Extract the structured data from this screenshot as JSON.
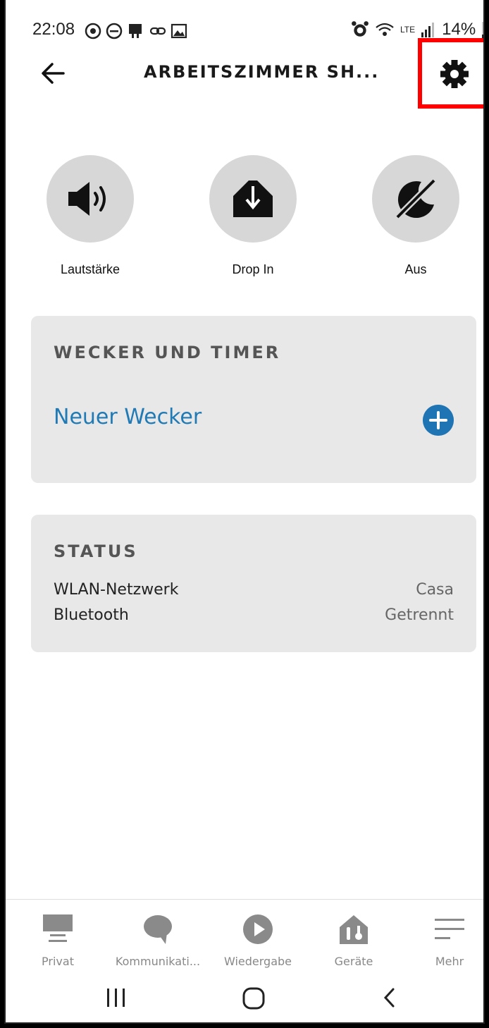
{
  "status_bar": {
    "time": "22:08",
    "battery": "14%",
    "network": "LTE"
  },
  "header": {
    "title": "ARBEITSZIMMER SH..."
  },
  "quick_actions": [
    {
      "label": "Lautstärke",
      "icon": "speaker-icon"
    },
    {
      "label": "Drop In",
      "icon": "drop-in-icon"
    },
    {
      "label": "Aus",
      "icon": "do-not-disturb-moon-icon"
    }
  ],
  "alarms_card": {
    "heading": "WECKER UND TIMER",
    "new_alarm_label": "Neuer Wecker"
  },
  "status_card": {
    "heading": "STATUS",
    "rows": [
      {
        "label": "WLAN-Netzwerk",
        "value": "Casa"
      },
      {
        "label": "Bluetooth",
        "value": "Getrennt"
      }
    ]
  },
  "bottom_nav": [
    {
      "label": "Privat",
      "icon": "home-icon"
    },
    {
      "label": "Kommunikati...",
      "icon": "chat-bubble-icon"
    },
    {
      "label": "Wiedergabe",
      "icon": "play-icon"
    },
    {
      "label": "Geräte",
      "icon": "devices-house-icon"
    },
    {
      "label": "Mehr",
      "icon": "menu-lines-icon"
    }
  ],
  "colors": {
    "accent_blue": "#1f75b4",
    "card_bg": "#e8e8e8",
    "circle_bg": "#d7d7d7",
    "highlight_red": "#ff0000"
  }
}
